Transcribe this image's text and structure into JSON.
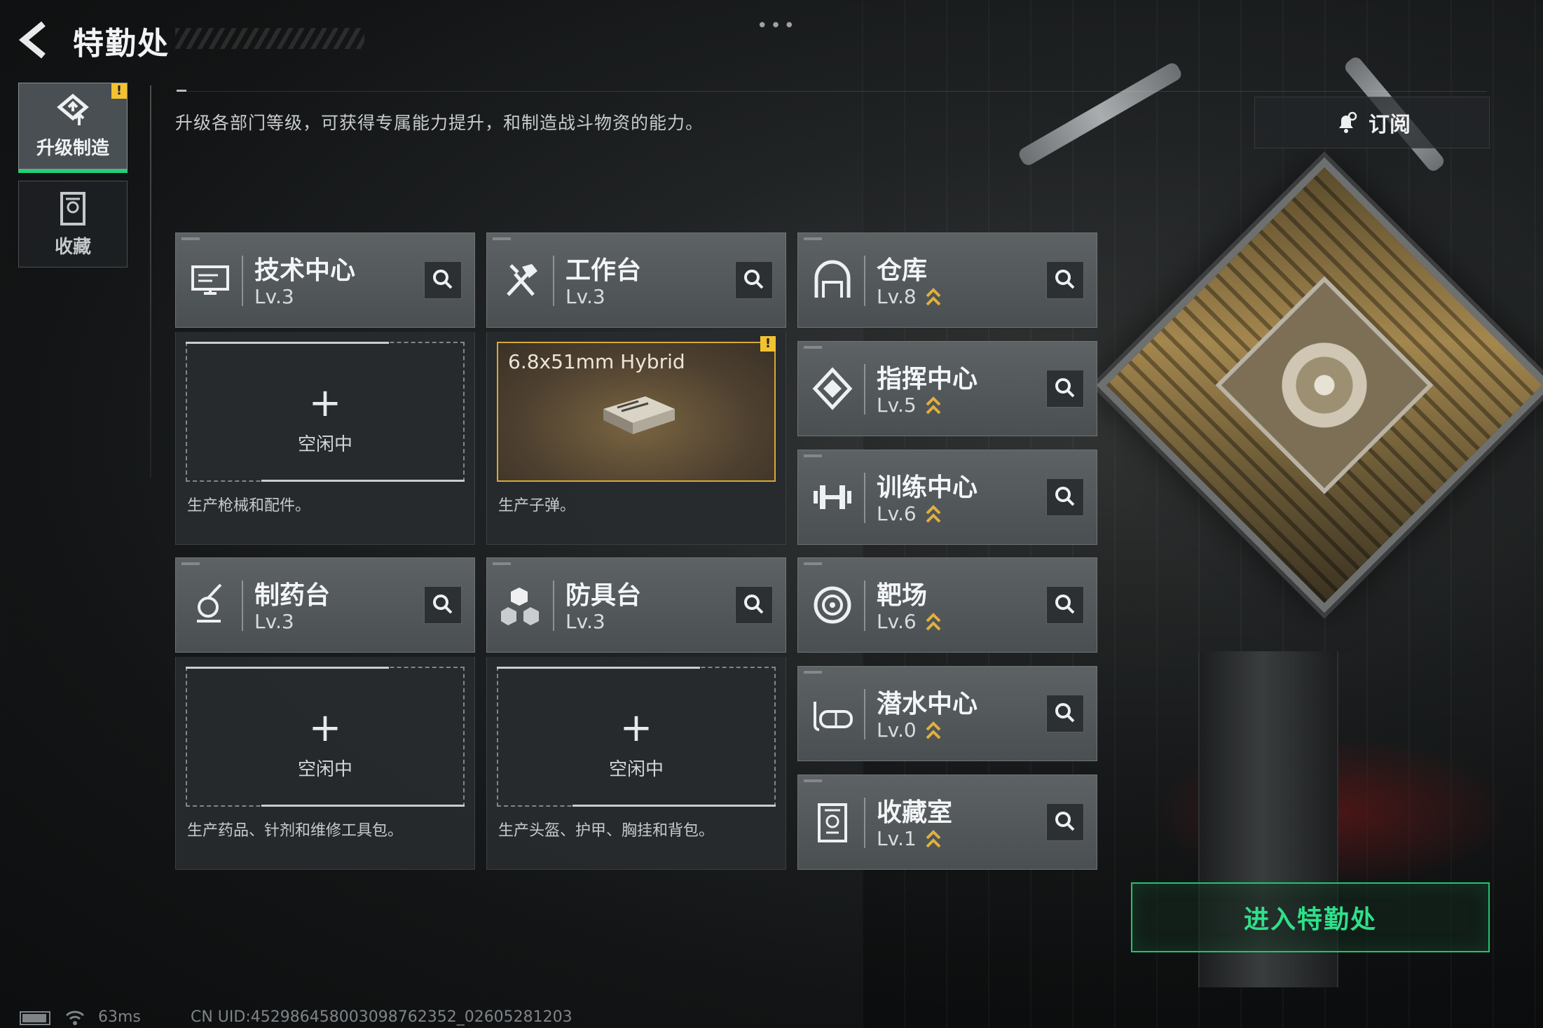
{
  "header": {
    "title": "特勤处",
    "back_icon": "back-arrow-icon",
    "more_icon": "more-dots-icon"
  },
  "sidebar": {
    "items": [
      {
        "label": "升级制造",
        "icon": "upgrade-icon",
        "active": true,
        "badge": "!"
      },
      {
        "label": "收藏",
        "icon": "collection-icon",
        "active": false
      }
    ]
  },
  "description": "升级各部门等级，可获得专属能力提升，和制造战斗物资的能力。",
  "subscribe": {
    "label": "订阅",
    "icon": "bell-icon"
  },
  "facilities": [
    {
      "name": "技术中心",
      "level": "Lv.3",
      "upgradable": false,
      "icon": "tech-center-icon",
      "slot": {
        "state": "idle",
        "plus": "+",
        "status": "空闲中"
      },
      "info": "生产枪械和配件。"
    },
    {
      "name": "工作台",
      "level": "Lv.3",
      "upgradable": false,
      "icon": "workbench-icon",
      "slot": {
        "state": "producing",
        "item": "6.8x51mm Hybrid",
        "badge": "!"
      },
      "info": "生产子弹。"
    },
    {
      "name": "仓库",
      "level": "Lv.8",
      "upgradable": true,
      "icon": "warehouse-icon"
    },
    {
      "name": "指挥中心",
      "level": "Lv.5",
      "upgradable": true,
      "icon": "command-center-icon"
    },
    {
      "name": "训练中心",
      "level": "Lv.6",
      "upgradable": true,
      "icon": "training-center-icon"
    },
    {
      "name": "制药台",
      "level": "Lv.3",
      "upgradable": false,
      "icon": "pharmacy-icon",
      "slot": {
        "state": "idle",
        "plus": "+",
        "status": "空闲中"
      },
      "info": "生产药品、针剂和维修工具包。"
    },
    {
      "name": "防具台",
      "level": "Lv.3",
      "upgradable": false,
      "icon": "armor-bench-icon",
      "slot": {
        "state": "idle",
        "plus": "+",
        "status": "空闲中"
      },
      "info": "生产头盔、护甲、胸挂和背包。"
    },
    {
      "name": "靶场",
      "level": "Lv.6",
      "upgradable": true,
      "icon": "shooting-range-icon"
    },
    {
      "name": "潜水中心",
      "level": "Lv.0",
      "upgradable": true,
      "icon": "diving-center-icon"
    },
    {
      "name": "收藏室",
      "level": "Lv.1",
      "upgradable": true,
      "icon": "collection-room-icon"
    }
  ],
  "enter_button": {
    "label": "进入特勤处"
  },
  "status_bar": {
    "ping": "63ms",
    "uid": "CN UID:452986458003098762352_02605281203"
  },
  "colors": {
    "accent_green": "#22c472",
    "warning_yellow": "#f2c230",
    "upgrade_gold": "#e0b040"
  }
}
